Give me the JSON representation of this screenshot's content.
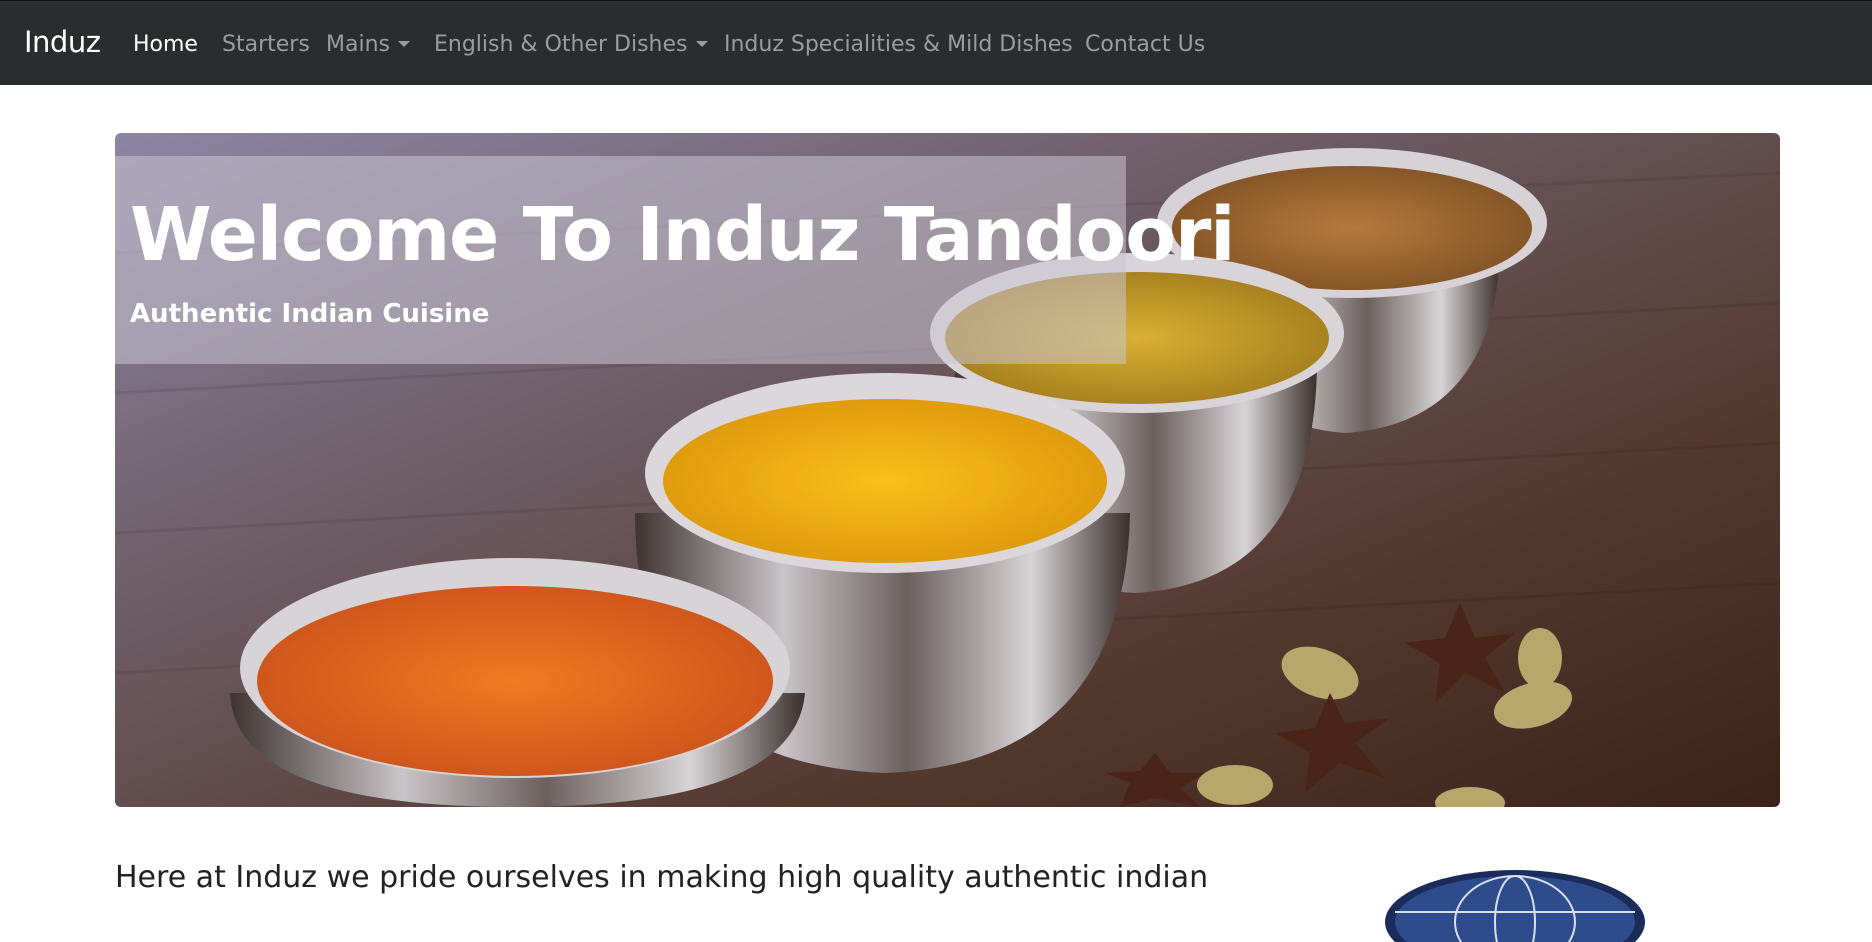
{
  "navbar": {
    "brand": "Induz",
    "items": [
      {
        "label": "Home",
        "active": true,
        "dropdown": false
      },
      {
        "label": "Starters",
        "active": false,
        "dropdown": false
      },
      {
        "label": "Mains",
        "active": false,
        "dropdown": true
      },
      {
        "label": "English & Other Dishes",
        "active": false,
        "dropdown": true
      },
      {
        "label": "Induz Specialities & Mild Dishes",
        "active": false,
        "dropdown": false
      },
      {
        "label": "Contact Us",
        "active": false,
        "dropdown": false
      }
    ]
  },
  "hero": {
    "title": "Welcome To Induz Tandoori",
    "subtitle": "Authentic Indian Cuisine"
  },
  "intro": {
    "text": "Here at Induz we pride ourselves in making high quality authentic indian"
  },
  "colors": {
    "navbar_bg": "#2b2c2d",
    "nav_text": "#9a9d9f",
    "nav_active": "#ffffff"
  }
}
